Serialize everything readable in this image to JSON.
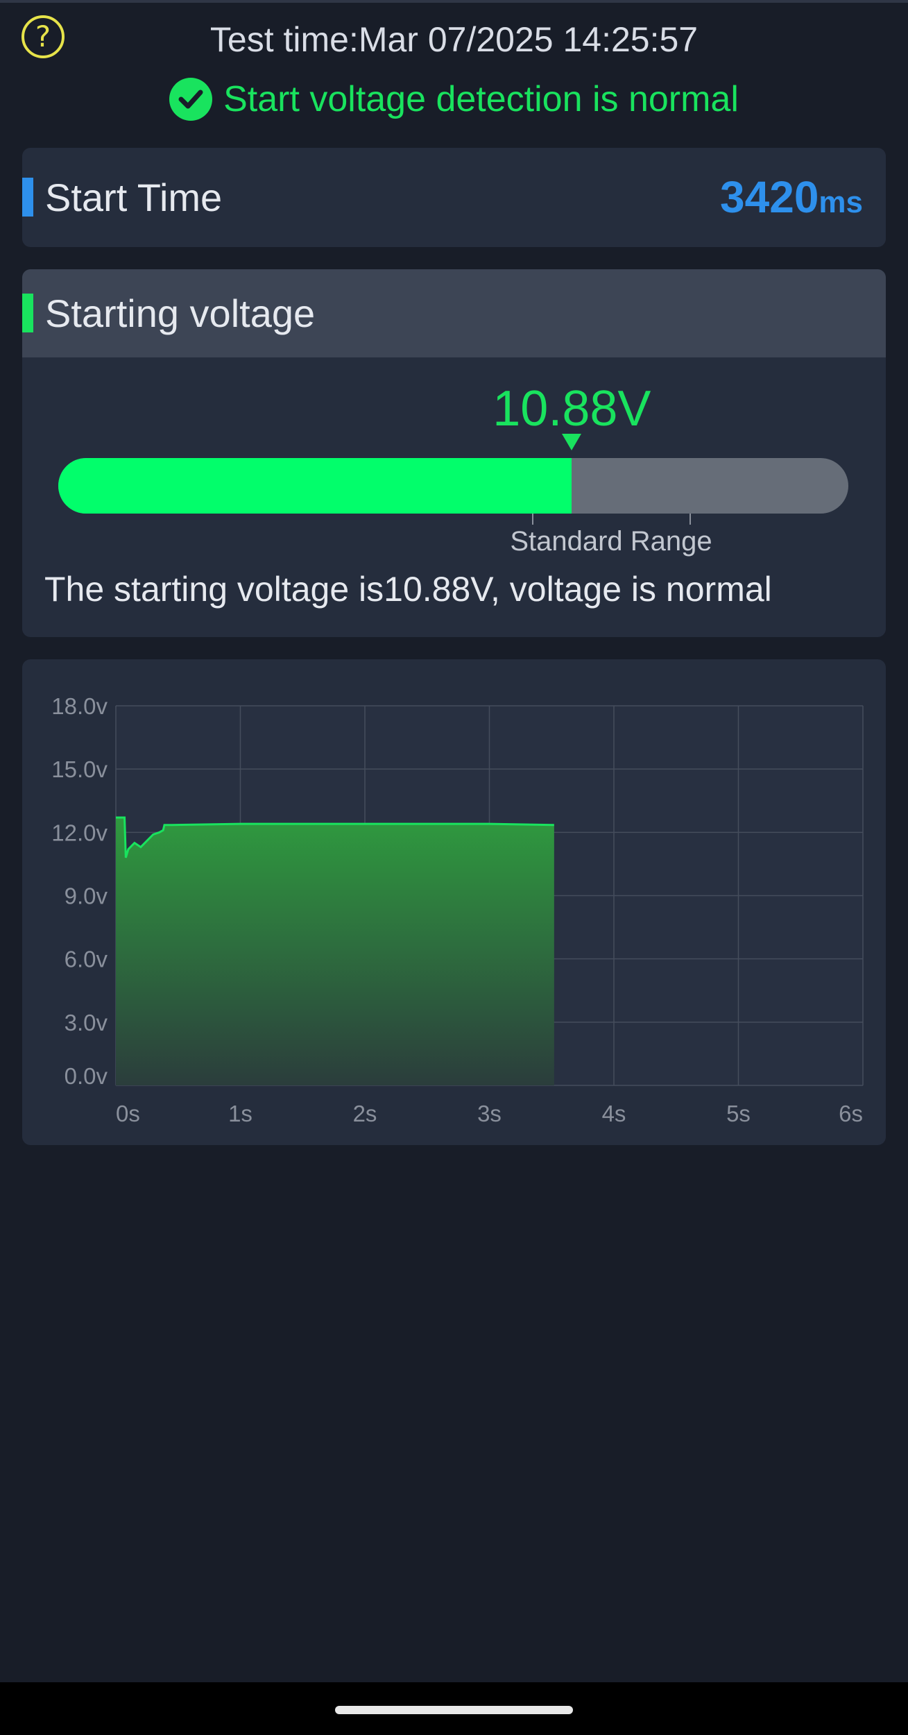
{
  "header": {
    "help_icon": "question-circle-icon",
    "test_time": "Test time:Mar 07/2025 14:25:57",
    "status_icon": "check-circle-icon",
    "status_text": "Start voltage detection is normal",
    "status_color": "#19e35e"
  },
  "start_time": {
    "label": "Start Time",
    "value": "3420",
    "unit": "ms",
    "accent_color": "#2e90ec"
  },
  "starting_voltage": {
    "label": "Starting voltage",
    "reading": "10.88V",
    "level_fraction": 0.65,
    "standard_range_label": "Standard Range",
    "description": "The starting voltage is10.88V, voltage is normal",
    "accent_color": "#19e35e"
  },
  "chart_data": {
    "type": "area",
    "title": "",
    "xlabel": "",
    "ylabel": "",
    "xlim": [
      0,
      6
    ],
    "ylim": [
      0,
      18
    ],
    "grid": true,
    "x_ticks": [
      "0s",
      "1s",
      "2s",
      "3s",
      "4s",
      "5s",
      "6s"
    ],
    "y_ticks": [
      "0.0v",
      "3.0v",
      "6.0v",
      "9.0v",
      "12.0v",
      "15.0v",
      "18.0v"
    ],
    "series": [
      {
        "color": "#19e35e",
        "x": [
          0.0,
          0.07,
          0.08,
          0.1,
          0.15,
          0.2,
          0.25,
          0.3,
          0.35,
          0.38,
          0.39,
          0.45,
          1.0,
          2.0,
          3.0,
          3.52
        ],
        "y": [
          12.7,
          12.7,
          10.8,
          11.2,
          11.5,
          11.3,
          11.6,
          11.9,
          12.0,
          12.1,
          12.35,
          12.35,
          12.4,
          12.4,
          12.4,
          12.35
        ]
      }
    ]
  }
}
